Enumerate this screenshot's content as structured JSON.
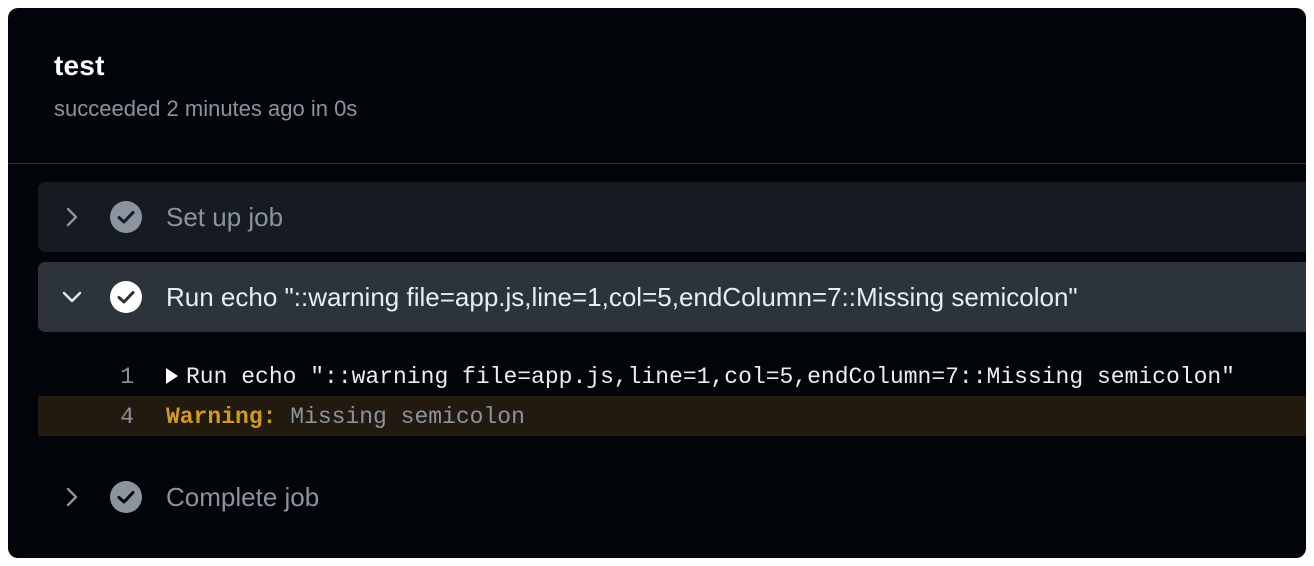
{
  "job": {
    "title": "test",
    "status": "succeeded 2 minutes ago in 0s"
  },
  "steps": [
    {
      "label": "Set up job",
      "expanded": false,
      "icon": "check-circle-icon"
    },
    {
      "label": "Run echo \"::warning file=app.js,line=1,col=5,endColumn=7::Missing semicolon\"",
      "expanded": true,
      "icon": "check-circle-icon"
    },
    {
      "label": "Complete job",
      "expanded": false,
      "icon": "check-circle-icon"
    }
  ],
  "log": [
    {
      "line": "1",
      "text": "Run echo \"::warning file=app.js,line=1,col=5,endColumn=7::Missing semicolon\""
    },
    {
      "line": "4",
      "warning_label": "Warning:",
      "message": "Missing semicolon"
    }
  ],
  "colors": {
    "background": "#010409",
    "step_bg": "#161b22",
    "step_expanded_bg": "#2d333b",
    "warning": "#d29922",
    "muted": "#8b949e"
  }
}
